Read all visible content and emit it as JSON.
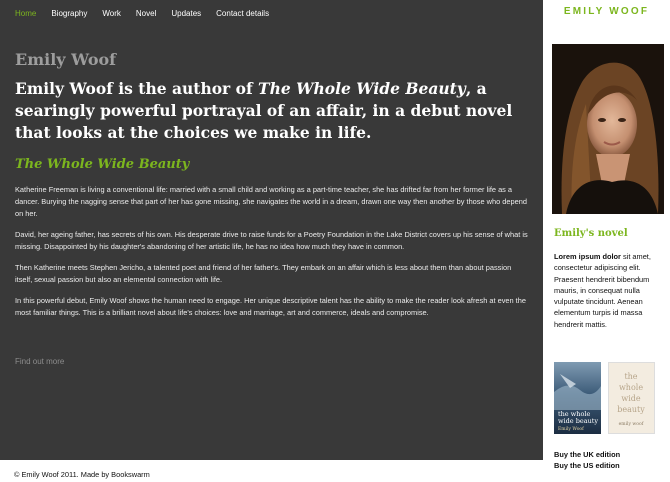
{
  "nav": {
    "items": [
      "Home",
      "Biography",
      "Work",
      "Novel",
      "Updates",
      "Contact details"
    ],
    "active": "Home",
    "active_color": "#7cb61e"
  },
  "main": {
    "site_name": "Emily Woof",
    "intro": {
      "before": "Emily Woof is the author of ",
      "title_italic": "The Whole Wide Beauty",
      "after": ", a searingly powerful portrayal of an affair, in a debut novel that looks at the choices we make in life."
    },
    "book_title": "The Whole Wide Beauty",
    "paragraphs": [
      "Katherine Freeman is living a conventional life: married with a small child and working as a part-time teacher, she has drifted far from her former life as a dancer. Burying the nagging sense that part of her has gone missing, she navigates the world in a dream, drawn one way then another by those who depend on her.",
      "David, her ageing father, has secrets of his own. His desperate drive to raise funds for a Poetry Foundation in the Lake District covers up his sense of what is missing. Disappointed by his daughter's abandoning of her artistic life, he has no idea how much they have in common.",
      "Then Katherine meets Stephen Jericho, a talented poet and friend of her father's. They embark on an affair which is less about them than about passion itself, sexual passion but also an elemental connection with life.",
      "In this powerful debut, Emily Woof shows the human need to engage. Her unique descriptive talent has the ability to make the reader look afresh at even the most familiar things. This is a brilliant novel about life's choices: love and marriage, art and commerce, ideals and compromise."
    ],
    "find_out_more": "Find out more"
  },
  "sidebar": {
    "heading": "EMILY WOOF",
    "novel_heading": "Emily's novel",
    "novel_text_bold": "Lorem ipsum dolor",
    "novel_text_rest": " sit amet, consectetur adipiscing elit. Praesent hendrerit bibendum mauris, in consequat nulla vulputate tincidunt. Aenean elementum turpis id massa hendrerit mattis.",
    "cover_uk": {
      "title": "the whole wide beauty",
      "author": "Emily Woof"
    },
    "cover_us": {
      "title": "the whole wide beauty",
      "author": "emily woof"
    },
    "buy_uk": "Buy the UK edition",
    "buy_us": "Buy the US edition"
  },
  "footer": {
    "copyright": "© Emily Woof 2011. Made by Bookswarm"
  },
  "colors": {
    "accent": "#7cb61e",
    "main_bg": "#393939"
  }
}
